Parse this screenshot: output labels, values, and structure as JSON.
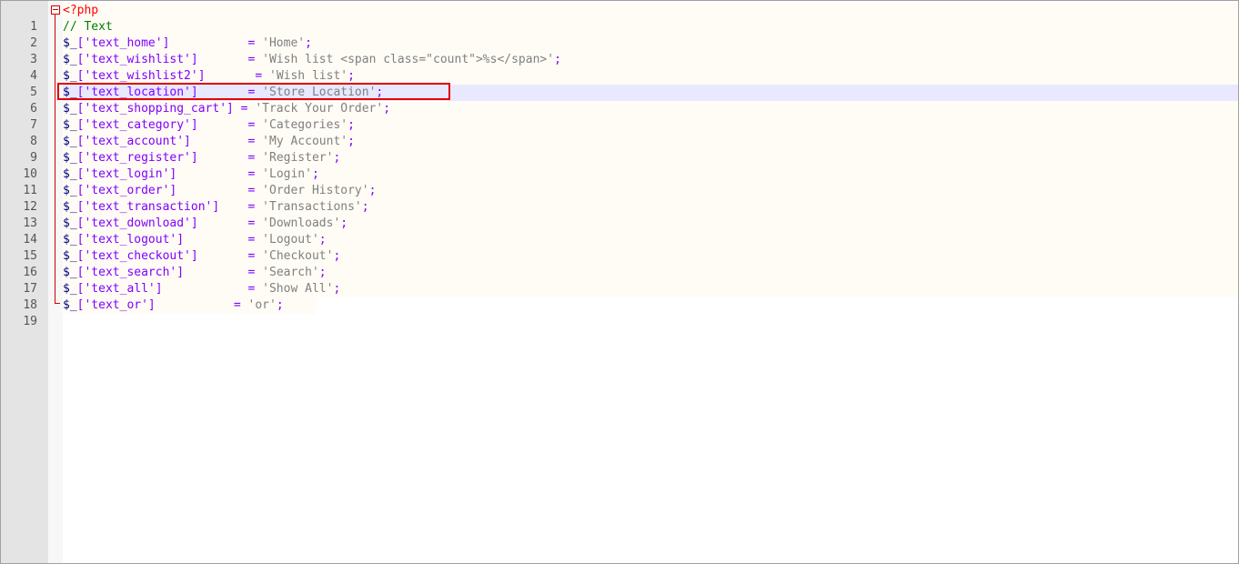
{
  "editor": {
    "lines": [
      {
        "num": "1",
        "text": "<?php"
      },
      {
        "num": "2",
        "text": "// Text"
      },
      {
        "num": "3",
        "var": "$_",
        "key": "['text_home']",
        "pad": "           ",
        "eq": "= ",
        "val": "'Home'",
        "end": ";"
      },
      {
        "num": "4",
        "var": "$_",
        "key": "['text_wishlist']",
        "pad": "       ",
        "eq": "= ",
        "val": "'Wish list <span class=\"count\">%s</span>'",
        "end": ";"
      },
      {
        "num": "5",
        "var": "$_",
        "key": "['text_wishlist2']",
        "pad": "       ",
        "eq": "= ",
        "val": "'Wish list'",
        "end": ";"
      },
      {
        "num": "6",
        "var": "$_",
        "key": "['text_location']",
        "pad": "       ",
        "eq": "= ",
        "val": "'Store Location'",
        "end": ";"
      },
      {
        "num": "7",
        "var": "$_",
        "key": "['text_shopping_cart']",
        "pad": " ",
        "eq": "= ",
        "val": "'Track Your Order'",
        "end": ";"
      },
      {
        "num": "8",
        "var": "$_",
        "key": "['text_category']",
        "pad": "       ",
        "eq": "= ",
        "val": "'Categories'",
        "end": ";"
      },
      {
        "num": "9",
        "var": "$_",
        "key": "['text_account']",
        "pad": "        ",
        "eq": "= ",
        "val": "'My Account'",
        "end": ";"
      },
      {
        "num": "10",
        "var": "$_",
        "key": "['text_register']",
        "pad": "       ",
        "eq": "= ",
        "val": "'Register'",
        "end": ";"
      },
      {
        "num": "11",
        "var": "$_",
        "key": "['text_login']",
        "pad": "          ",
        "eq": "= ",
        "val": "'Login'",
        "end": ";"
      },
      {
        "num": "12",
        "var": "$_",
        "key": "['text_order']",
        "pad": "          ",
        "eq": "= ",
        "val": "'Order History'",
        "end": ";"
      },
      {
        "num": "13",
        "var": "$_",
        "key": "['text_transaction']",
        "pad": "    ",
        "eq": "= ",
        "val": "'Transactions'",
        "end": ";"
      },
      {
        "num": "14",
        "var": "$_",
        "key": "['text_download']",
        "pad": "       ",
        "eq": "= ",
        "val": "'Downloads'",
        "end": ";"
      },
      {
        "num": "15",
        "var": "$_",
        "key": "['text_logout']",
        "pad": "         ",
        "eq": "= ",
        "val": "'Logout'",
        "end": ";"
      },
      {
        "num": "16",
        "var": "$_",
        "key": "['text_checkout']",
        "pad": "       ",
        "eq": "= ",
        "val": "'Checkout'",
        "end": ";"
      },
      {
        "num": "17",
        "var": "$_",
        "key": "['text_search']",
        "pad": "         ",
        "eq": "= ",
        "val": "'Search'",
        "end": ";"
      },
      {
        "num": "18",
        "var": "$_",
        "key": "['text_all']",
        "pad": "            ",
        "eq": "= ",
        "val": "'Show All'",
        "end": ";"
      },
      {
        "num": "19",
        "var": "$_",
        "key": "['text_or']",
        "pad": "           ",
        "eq": "= ",
        "val": "'or'",
        "end": ";"
      }
    ]
  },
  "colors": {
    "highlight_border": "#e00000",
    "current_line": "#e8e8ff",
    "php_tag": "#ff0000",
    "comment": "#008000",
    "operator": "#8000ff",
    "string": "#808080"
  }
}
